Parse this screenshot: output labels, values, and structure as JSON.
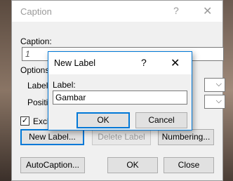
{
  "caption_dialog": {
    "title": "Caption",
    "help": "?",
    "close": "✕",
    "caption_label": "Caption:",
    "caption_value": "1",
    "options_label": "Options",
    "label_label": "Label:",
    "position_label": "Positio",
    "exclude_label": "Exclu",
    "exclude_checked": "✓",
    "new_label_button": "New Label...",
    "delete_label_button": "Delete Label",
    "numbering_button": "Numbering...",
    "autocaption_button": "AutoCaption...",
    "ok_button": "OK",
    "close_button": "Close"
  },
  "new_label_dialog": {
    "title": "New Label",
    "help": "?",
    "close": "✕",
    "label_label": "Label:",
    "label_value": "Gambar",
    "ok_button": "OK",
    "cancel_button": "Cancel"
  },
  "colors": {
    "accent": "#0078d7",
    "dialog_bg": "#f0f0f0"
  }
}
